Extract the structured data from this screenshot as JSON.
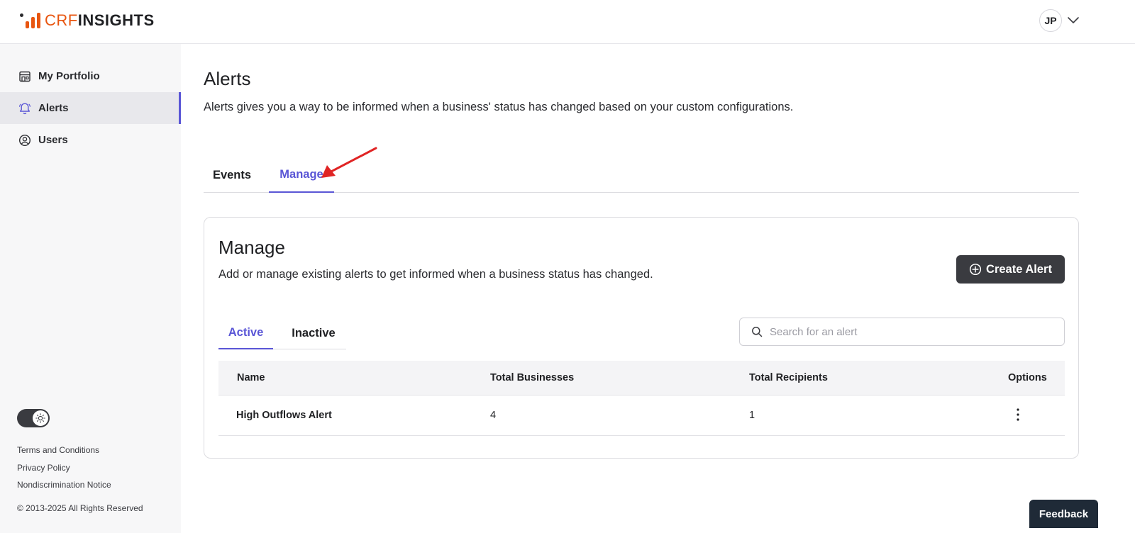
{
  "header": {
    "logo": {
      "part1": "CRF",
      "part2": "INSIGHTS"
    },
    "user_initials": "JP"
  },
  "sidebar": {
    "items": [
      {
        "label": "My Portfolio",
        "icon": "storefront-icon",
        "active": false
      },
      {
        "label": "Alerts",
        "icon": "bell-icon",
        "active": true
      },
      {
        "label": "Users",
        "icon": "user-circle-icon",
        "active": false
      }
    ],
    "theme_toggle_icon": "sun-icon",
    "footer_links": [
      "Terms and Conditions",
      "Privacy Policy",
      "Nondiscrimination Notice"
    ],
    "copyright": "© 2013-2025 All Rights Reserved"
  },
  "page": {
    "title": "Alerts",
    "description": "Alerts gives you a way to be informed when a business' status has changed based on your custom configurations.",
    "tabs": [
      {
        "label": "Events",
        "active": false
      },
      {
        "label": "Manage",
        "active": true
      }
    ]
  },
  "manage": {
    "title": "Manage",
    "description": "Add or manage existing alerts to get informed when a business status has changed.",
    "create_button": "Create Alert",
    "subtabs": [
      {
        "label": "Active",
        "active": true
      },
      {
        "label": "Inactive",
        "active": false
      }
    ],
    "search_placeholder": "Search for an alert",
    "search_value": "",
    "table": {
      "columns": [
        "Name",
        "Total Businesses",
        "Total Recipients",
        "Options"
      ],
      "rows": [
        {
          "name": "High Outflows Alert",
          "total_businesses": "4",
          "total_recipients": "1"
        }
      ]
    }
  },
  "feedback_label": "Feedback",
  "colors": {
    "accent": "#5a56d6",
    "brand_orange": "#e8550f",
    "dark_button": "#3a3b40",
    "annotation_arrow": "#e02424"
  }
}
